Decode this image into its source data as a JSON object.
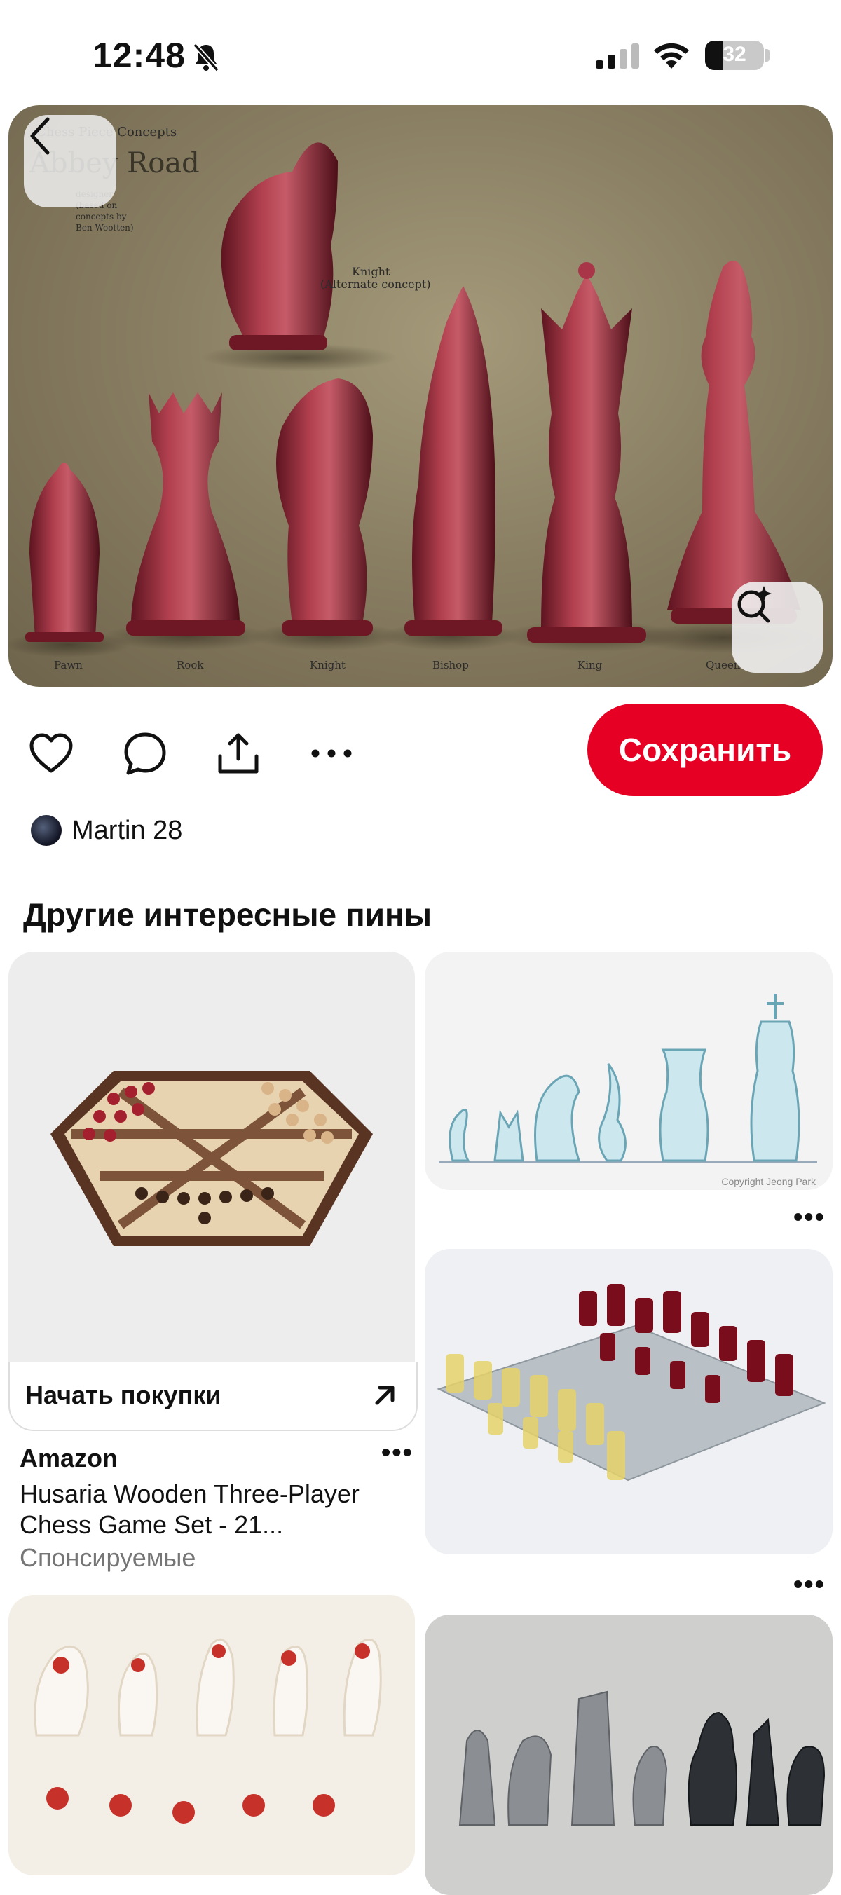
{
  "status_bar": {
    "time": "12:48",
    "battery": "32"
  },
  "hero": {
    "annotations": {
      "title_line1": "Chess Piece Concepts",
      "title_line2": "Abbey Road",
      "side_note_1": "designer",
      "side_note_2": "(based on",
      "side_note_3": "concepts by",
      "side_note_4": "Ben Wootten)",
      "knight_alt_1": "Knight",
      "knight_alt_2": "(Alternate concept)"
    },
    "piece_labels": [
      "Pawn",
      "Rook",
      "Knight",
      "Bishop",
      "King",
      "Queen"
    ]
  },
  "actions": {
    "save_label": "Сохранить"
  },
  "author": {
    "name": "Martin 28"
  },
  "section": {
    "title": "Другие интересные пины"
  },
  "pins": {
    "shop_label": "Начать покупки",
    "brand": "Amazon",
    "description": "Husaria Wooden Three-Player Chess Game Set - 21...",
    "sponsored": "Спонсируемые",
    "copyright": "Copyright Jeong Park"
  },
  "colors": {
    "accent": "#e60023",
    "piece_red": "#9e2a3a"
  },
  "icons": [
    "back-chevron-icon",
    "visual-search-icon",
    "heart-icon",
    "comment-icon",
    "share-icon",
    "more-icon",
    "arrow-up-right-icon"
  ]
}
